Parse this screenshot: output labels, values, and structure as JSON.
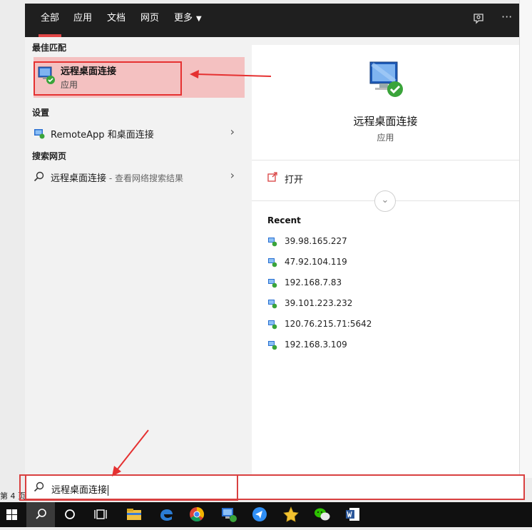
{
  "tabs": [
    {
      "label": "全部"
    },
    {
      "label": "应用"
    },
    {
      "label": "文档"
    },
    {
      "label": "网页"
    },
    {
      "label": "更多"
    }
  ],
  "left": {
    "best_match_heading": "最佳匹配",
    "best_match": {
      "name": "远程桌面连接",
      "type": "应用"
    },
    "settings_heading": "设置",
    "settings_item": "RemoteApp 和桌面连接",
    "web_heading": "搜索网页",
    "web_item": "远程桌面连接",
    "web_item_hint": " - 查看网络搜索结果"
  },
  "preview": {
    "title": "远程桌面连接",
    "subtitle": "应用",
    "open_label": "打开",
    "recent_heading": "Recent",
    "recent": [
      {
        "label": "39.98.165.227"
      },
      {
        "label": "47.92.104.119"
      },
      {
        "label": "192.168.7.83"
      },
      {
        "label": "39.101.223.232"
      },
      {
        "label": "120.76.215.71:5642"
      },
      {
        "label": "192.168.3.109"
      }
    ]
  },
  "search": {
    "value": "远程桌面连接"
  },
  "background_doc": {
    "page_label": "第 4 页"
  },
  "colors": {
    "accent": "#e04646",
    "highlight": "#f4c1c1",
    "annotation": "#e53131",
    "taskbar": "#101010"
  }
}
